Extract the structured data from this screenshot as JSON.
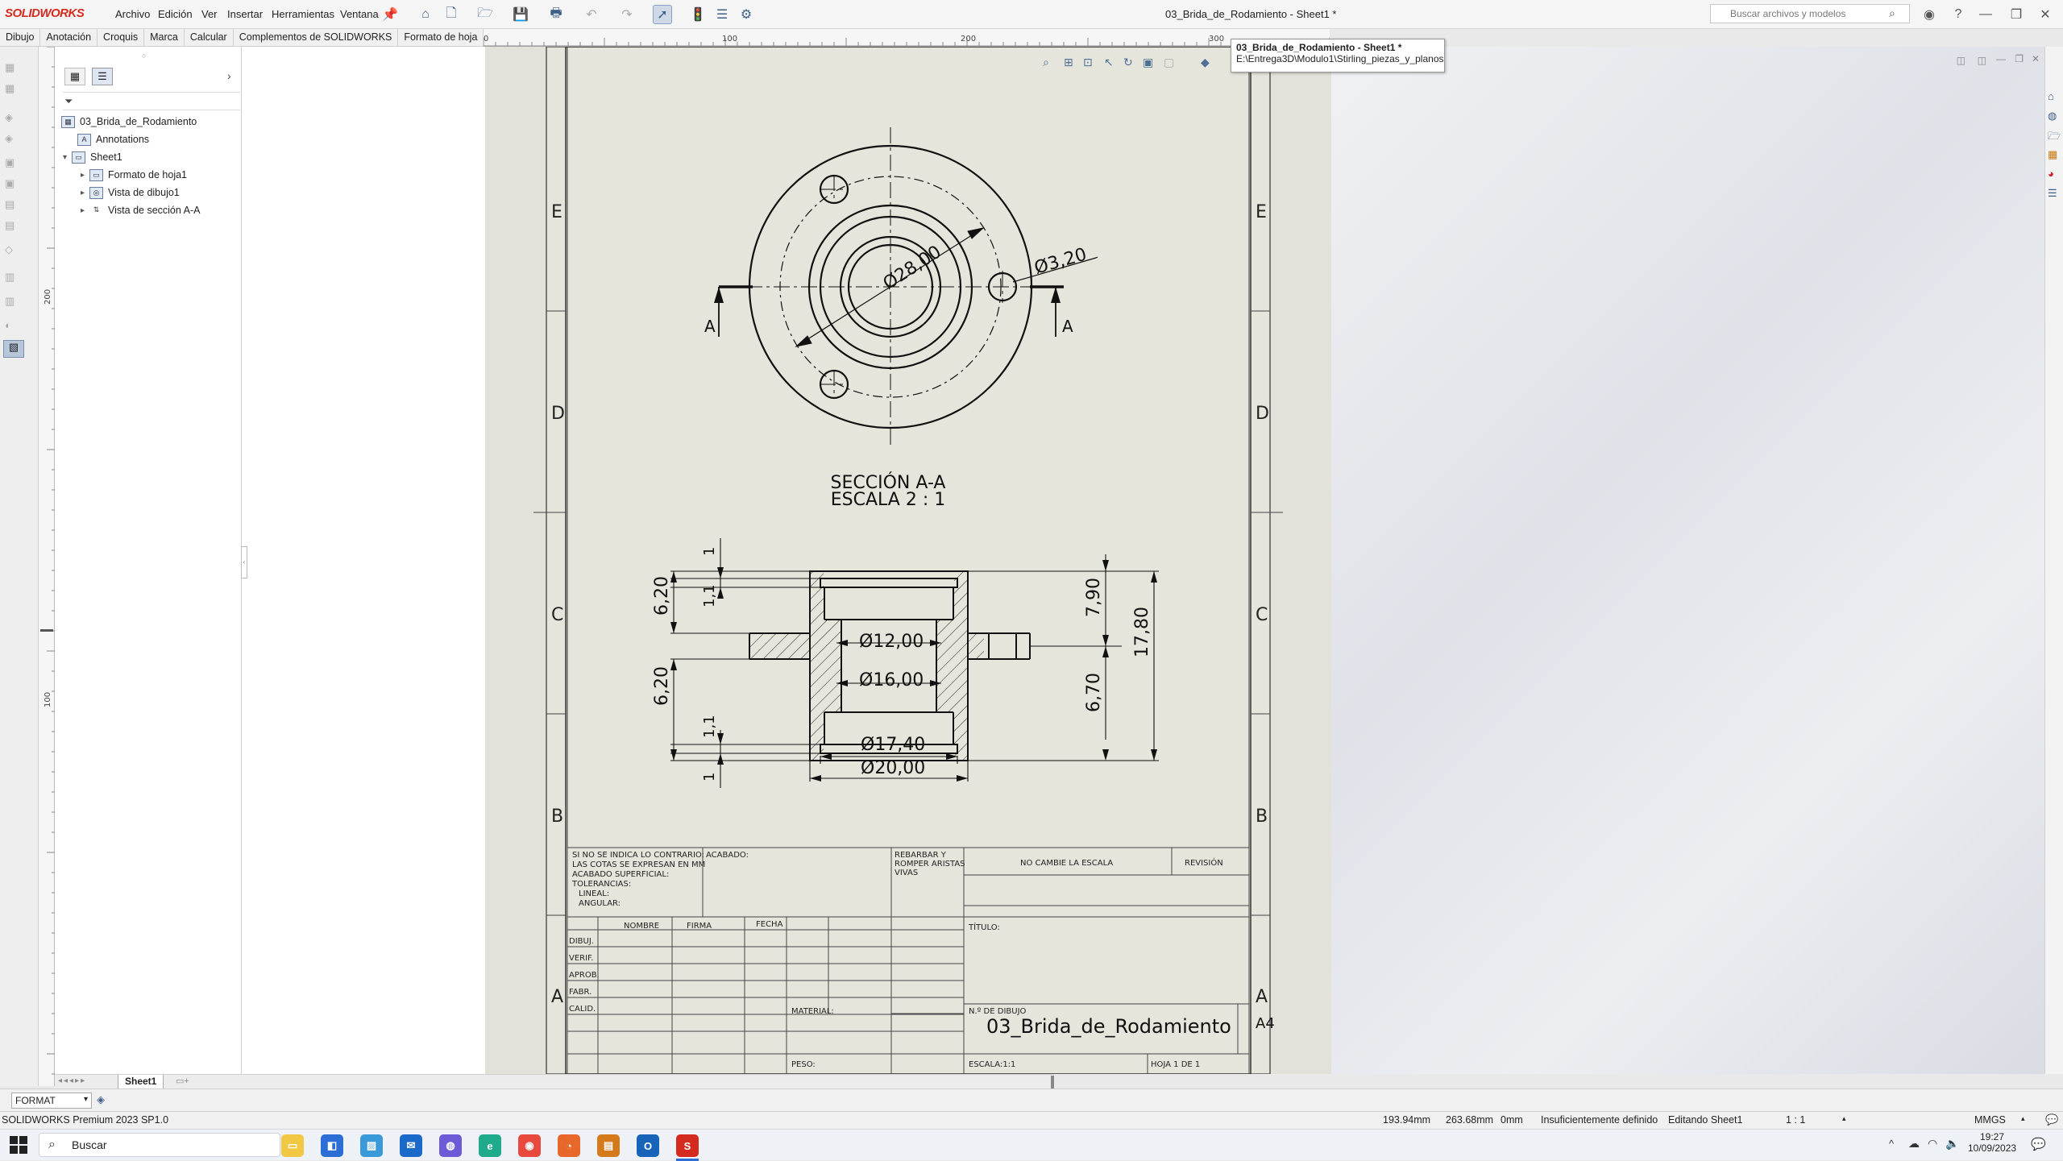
{
  "app": {
    "logo_text": "SOLIDWORKS",
    "menu": [
      "Archivo",
      "Edición",
      "Ver",
      "Insertar",
      "Herramientas",
      "Ventana"
    ],
    "window_title": "03_Brida_de_Rodamiento - Sheet1 *",
    "search_placeholder": "Buscar archivos y modelos"
  },
  "command_tabs": [
    "Dibujo",
    "Anotación",
    "Croquis",
    "Marca",
    "Calcular",
    "Complementos de SOLIDWORKS",
    "Formato de hoja"
  ],
  "ruler": {
    "labels": [
      "0",
      "100",
      "200",
      "300"
    ]
  },
  "vruler": {
    "labels": [
      "200",
      "100"
    ]
  },
  "tree": {
    "root": "03_Brida_de_Rodamiento",
    "annotations": "Annotations",
    "sheet": "Sheet1",
    "children": [
      "Formato de hoja1",
      "Vista de dibujo1",
      "Vista de sección A-A"
    ]
  },
  "tooltip": {
    "title": "03_Brida_de_Rodamiento - Sheet1 *",
    "path": "E:\\Entrega3D\\Modulo1\\Stirling_piezas_y_planos"
  },
  "drawing": {
    "zone_letters": [
      "E",
      "D",
      "C",
      "B",
      "A"
    ],
    "section_marker": "A",
    "dim_diameter_pitch": "Ø28,00",
    "dim_hole": "Ø3,20",
    "section_title": "SECCIÓN A-A",
    "section_scale": "ESCALA 2 : 1",
    "dims_section": {
      "d12": "Ø12,00",
      "d16": "Ø16,00",
      "d17_4": "Ø17,40",
      "d20": "Ø20,00",
      "h7_9": "7,90",
      "h6_7": "6,70",
      "h17_8": "17,80",
      "h6_2_top": "6,20",
      "h6_2_bot": "6,20",
      "small_1_top": "1",
      "small_1_1_top": "1,1",
      "small_1_1_bot": "1,1",
      "small_1_bot": "1"
    }
  },
  "title_block": {
    "notes": [
      "SI NO SE INDICA LO CONTRARIO:",
      "LAS COTAS SE EXPRESAN EN MM",
      "ACABADO SUPERFICIAL:",
      "TOLERANCIAS:",
      "   LINEAL:",
      "   ANGULAR:"
    ],
    "acabado": "ACABADO:",
    "rebarbar": [
      "REBARBAR Y",
      "ROMPER ARISTAS",
      "VIVAS"
    ],
    "no_escala": "NO CAMBIE LA ESCALA",
    "revision": "REVISIÓN",
    "col_nombre": "NOMBRE",
    "col_firma": "FIRMA",
    "col_fecha": "FECHA",
    "rows": [
      "DIBUJ.",
      "VERIF.",
      "APROB.",
      "FABR.",
      "CALID."
    ],
    "titulo": "TÍTULO:",
    "material": "MATERIAL:",
    "n_dibujo_label": "N.º DE DIBUJO",
    "n_dibujo": "03_Brida_de_Rodamiento",
    "size": "A4",
    "peso": "PESO:",
    "escala": "ESCALA:1:1",
    "hoja": "HOJA 1 DE 1"
  },
  "sheet_tab": "Sheet1",
  "format_select": "FORMAT",
  "status": {
    "product": "SOLIDWORKS Premium 2023 SP1.0",
    "x": "193.94mm",
    "y": "263.68mm",
    "z": "0mm",
    "definition": "Insuficientemente definido",
    "mode": "Editando Sheet1",
    "scale": "1 : 1",
    "units": "MMGS"
  },
  "taskbar": {
    "search": "Buscar",
    "time": "19:27",
    "date": "10/09/2023"
  }
}
